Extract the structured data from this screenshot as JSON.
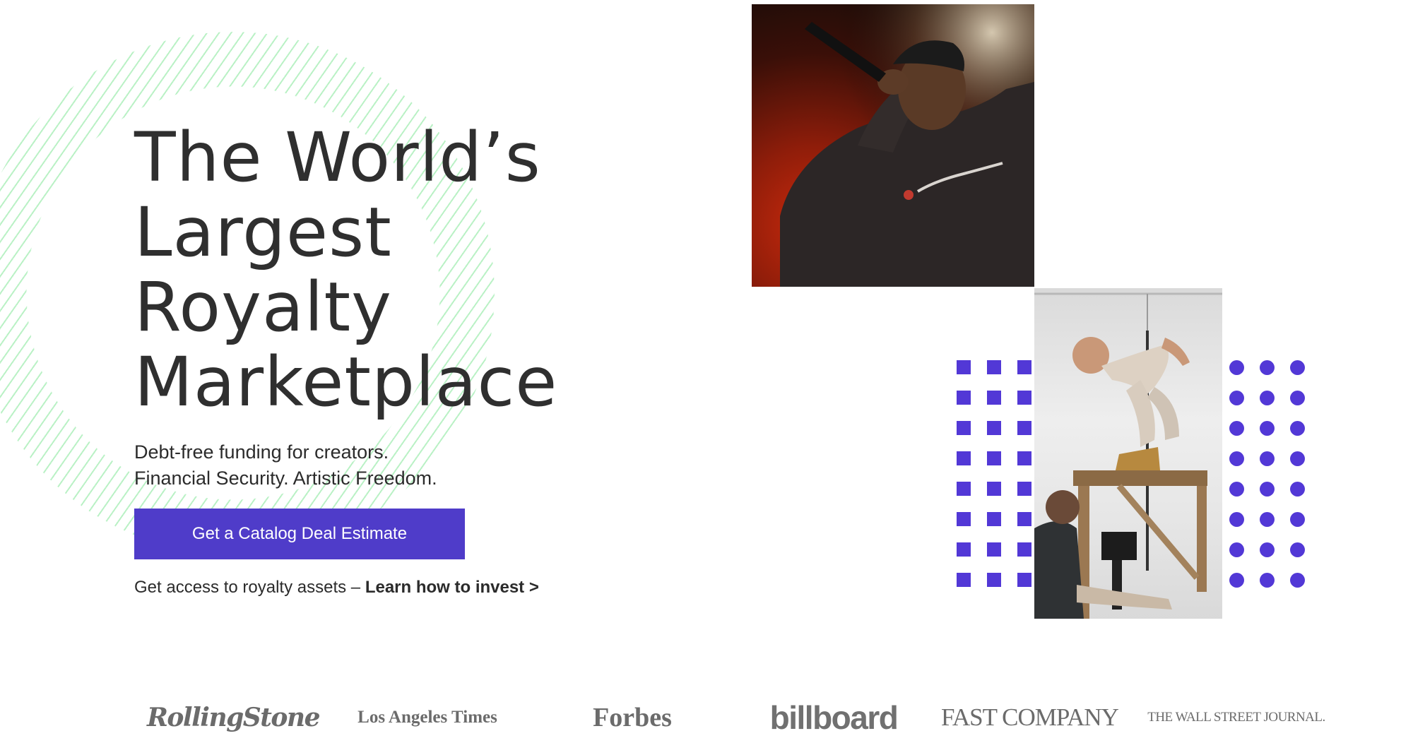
{
  "hero": {
    "headline_lines": [
      "The World’s",
      "Largest Royalty",
      "Marketplace"
    ],
    "subtitle_lines": [
      "Debt-free funding for creators.",
      "Financial Security. Artistic Freedom."
    ],
    "cta_label": "Get a Catalog Deal Estimate",
    "invest_prefix": "Get access to royalty assets – ",
    "invest_link_label": "Learn how to invest >"
  },
  "press": {
    "logos": [
      "RollingStone",
      "Los Angeles Times",
      "Forbes",
      "billboard",
      "FAST COMPANY",
      "THE WALL STREET JOURNAL."
    ]
  },
  "colors": {
    "accent": "#4f3cc9",
    "dots": "#5238d6",
    "hatch": "#81e696",
    "text": "#2b2b2b"
  }
}
